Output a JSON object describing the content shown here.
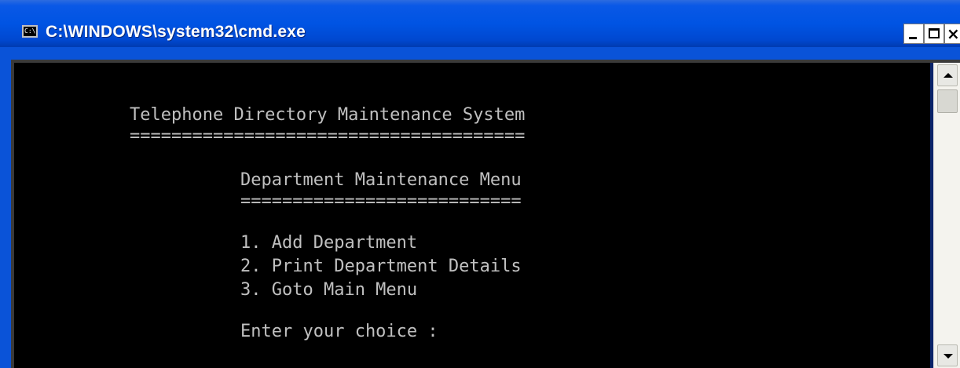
{
  "window": {
    "title": "C:\\WINDOWS\\system32\\cmd.exe",
    "icon_label": "C:\\",
    "icon": "cmd-console-icon",
    "buttons": {
      "minimize_icon": "minimize-icon",
      "maximize_icon": "maximize-icon",
      "close_icon": "close-icon",
      "close_glyph": "×"
    }
  },
  "console": {
    "lines": [
      "Telephone Directory Maintenance System",
      "======================================",
      "Department Maintenance Menu",
      "===========================",
      "1. Add Department",
      "2. Print Department Details",
      "3. Goto Main Menu",
      "Enter your choice :"
    ],
    "foreground": "#c0c0c0",
    "background": "#000000"
  },
  "scrollbar": {
    "up_icon": "scroll-up-arrow-icon",
    "down_icon": "scroll-down-arrow-icon"
  },
  "colors": {
    "titlebar": "#0054e3",
    "frame": "#0a53d8"
  }
}
